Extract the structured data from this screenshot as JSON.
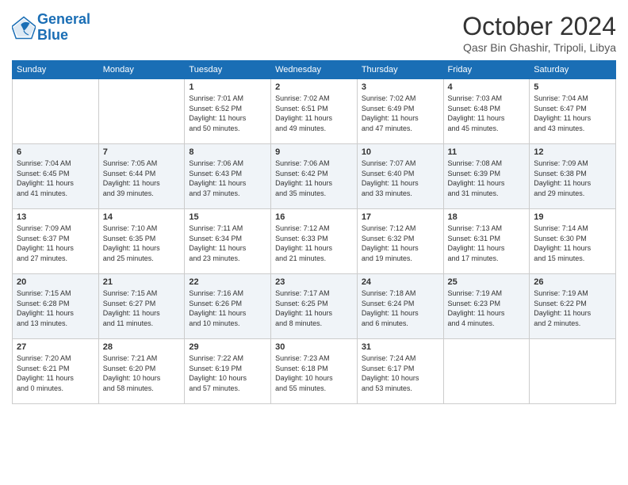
{
  "logo": {
    "line1": "General",
    "line2": "Blue"
  },
  "header": {
    "month": "October 2024",
    "location": "Qasr Bin Ghashir, Tripoli, Libya"
  },
  "weekdays": [
    "Sunday",
    "Monday",
    "Tuesday",
    "Wednesday",
    "Thursday",
    "Friday",
    "Saturday"
  ],
  "weeks": [
    [
      {
        "day": "",
        "info": ""
      },
      {
        "day": "",
        "info": ""
      },
      {
        "day": "1",
        "info": "Sunrise: 7:01 AM\nSunset: 6:52 PM\nDaylight: 11 hours\nand 50 minutes."
      },
      {
        "day": "2",
        "info": "Sunrise: 7:02 AM\nSunset: 6:51 PM\nDaylight: 11 hours\nand 49 minutes."
      },
      {
        "day": "3",
        "info": "Sunrise: 7:02 AM\nSunset: 6:49 PM\nDaylight: 11 hours\nand 47 minutes."
      },
      {
        "day": "4",
        "info": "Sunrise: 7:03 AM\nSunset: 6:48 PM\nDaylight: 11 hours\nand 45 minutes."
      },
      {
        "day": "5",
        "info": "Sunrise: 7:04 AM\nSunset: 6:47 PM\nDaylight: 11 hours\nand 43 minutes."
      }
    ],
    [
      {
        "day": "6",
        "info": "Sunrise: 7:04 AM\nSunset: 6:45 PM\nDaylight: 11 hours\nand 41 minutes."
      },
      {
        "day": "7",
        "info": "Sunrise: 7:05 AM\nSunset: 6:44 PM\nDaylight: 11 hours\nand 39 minutes."
      },
      {
        "day": "8",
        "info": "Sunrise: 7:06 AM\nSunset: 6:43 PM\nDaylight: 11 hours\nand 37 minutes."
      },
      {
        "day": "9",
        "info": "Sunrise: 7:06 AM\nSunset: 6:42 PM\nDaylight: 11 hours\nand 35 minutes."
      },
      {
        "day": "10",
        "info": "Sunrise: 7:07 AM\nSunset: 6:40 PM\nDaylight: 11 hours\nand 33 minutes."
      },
      {
        "day": "11",
        "info": "Sunrise: 7:08 AM\nSunset: 6:39 PM\nDaylight: 11 hours\nand 31 minutes."
      },
      {
        "day": "12",
        "info": "Sunrise: 7:09 AM\nSunset: 6:38 PM\nDaylight: 11 hours\nand 29 minutes."
      }
    ],
    [
      {
        "day": "13",
        "info": "Sunrise: 7:09 AM\nSunset: 6:37 PM\nDaylight: 11 hours\nand 27 minutes."
      },
      {
        "day": "14",
        "info": "Sunrise: 7:10 AM\nSunset: 6:35 PM\nDaylight: 11 hours\nand 25 minutes."
      },
      {
        "day": "15",
        "info": "Sunrise: 7:11 AM\nSunset: 6:34 PM\nDaylight: 11 hours\nand 23 minutes."
      },
      {
        "day": "16",
        "info": "Sunrise: 7:12 AM\nSunset: 6:33 PM\nDaylight: 11 hours\nand 21 minutes."
      },
      {
        "day": "17",
        "info": "Sunrise: 7:12 AM\nSunset: 6:32 PM\nDaylight: 11 hours\nand 19 minutes."
      },
      {
        "day": "18",
        "info": "Sunrise: 7:13 AM\nSunset: 6:31 PM\nDaylight: 11 hours\nand 17 minutes."
      },
      {
        "day": "19",
        "info": "Sunrise: 7:14 AM\nSunset: 6:30 PM\nDaylight: 11 hours\nand 15 minutes."
      }
    ],
    [
      {
        "day": "20",
        "info": "Sunrise: 7:15 AM\nSunset: 6:28 PM\nDaylight: 11 hours\nand 13 minutes."
      },
      {
        "day": "21",
        "info": "Sunrise: 7:15 AM\nSunset: 6:27 PM\nDaylight: 11 hours\nand 11 minutes."
      },
      {
        "day": "22",
        "info": "Sunrise: 7:16 AM\nSunset: 6:26 PM\nDaylight: 11 hours\nand 10 minutes."
      },
      {
        "day": "23",
        "info": "Sunrise: 7:17 AM\nSunset: 6:25 PM\nDaylight: 11 hours\nand 8 minutes."
      },
      {
        "day": "24",
        "info": "Sunrise: 7:18 AM\nSunset: 6:24 PM\nDaylight: 11 hours\nand 6 minutes."
      },
      {
        "day": "25",
        "info": "Sunrise: 7:19 AM\nSunset: 6:23 PM\nDaylight: 11 hours\nand 4 minutes."
      },
      {
        "day": "26",
        "info": "Sunrise: 7:19 AM\nSunset: 6:22 PM\nDaylight: 11 hours\nand 2 minutes."
      }
    ],
    [
      {
        "day": "27",
        "info": "Sunrise: 7:20 AM\nSunset: 6:21 PM\nDaylight: 11 hours\nand 0 minutes."
      },
      {
        "day": "28",
        "info": "Sunrise: 7:21 AM\nSunset: 6:20 PM\nDaylight: 10 hours\nand 58 minutes."
      },
      {
        "day": "29",
        "info": "Sunrise: 7:22 AM\nSunset: 6:19 PM\nDaylight: 10 hours\nand 57 minutes."
      },
      {
        "day": "30",
        "info": "Sunrise: 7:23 AM\nSunset: 6:18 PM\nDaylight: 10 hours\nand 55 minutes."
      },
      {
        "day": "31",
        "info": "Sunrise: 7:24 AM\nSunset: 6:17 PM\nDaylight: 10 hours\nand 53 minutes."
      },
      {
        "day": "",
        "info": ""
      },
      {
        "day": "",
        "info": ""
      }
    ]
  ]
}
